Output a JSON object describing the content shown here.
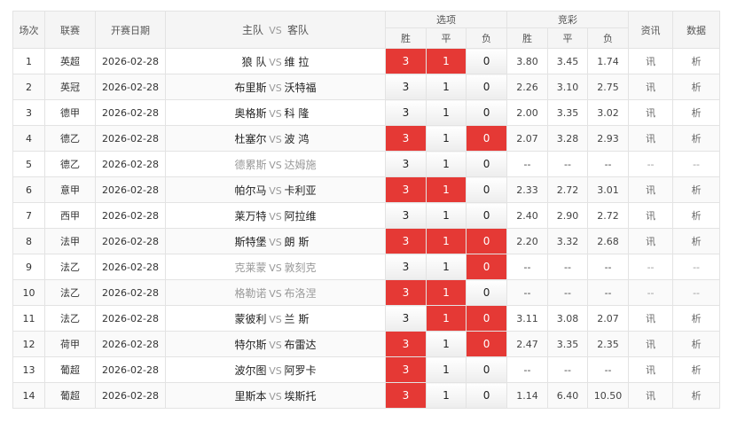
{
  "header": {
    "index": "场次",
    "league": "联赛",
    "date": "开赛日期",
    "home": "主队",
    "vs": "VS",
    "away": "客队",
    "options": "选项",
    "jingcai": "竞彩",
    "news": "资讯",
    "stats": "数据",
    "sub": [
      "胜",
      "平",
      "负",
      "胜",
      "平",
      "负"
    ]
  },
  "rows": [
    {
      "idx": "1",
      "league": "英超",
      "date": "2026-02-28",
      "home": "狼 队",
      "away": "维 拉",
      "opts": [
        "3",
        "1",
        "0"
      ],
      "sel": [
        true,
        true,
        false
      ],
      "odds": [
        "3.80",
        "3.45",
        "1.74"
      ],
      "news": "讯",
      "stats": "析",
      "grey": false
    },
    {
      "idx": "2",
      "league": "英冠",
      "date": "2026-02-28",
      "home": "布里斯",
      "away": "沃特福",
      "opts": [
        "3",
        "1",
        "0"
      ],
      "sel": [
        false,
        false,
        false
      ],
      "odds": [
        "2.26",
        "3.10",
        "2.75"
      ],
      "news": "讯",
      "stats": "析",
      "grey": false
    },
    {
      "idx": "3",
      "league": "德甲",
      "date": "2026-02-28",
      "home": "奥格斯",
      "away": "科 隆",
      "opts": [
        "3",
        "1",
        "0"
      ],
      "sel": [
        false,
        false,
        false
      ],
      "odds": [
        "2.00",
        "3.35",
        "3.02"
      ],
      "news": "讯",
      "stats": "析",
      "grey": false
    },
    {
      "idx": "4",
      "league": "德乙",
      "date": "2026-02-28",
      "home": "杜塞尔",
      "away": "波 鸿",
      "opts": [
        "3",
        "1",
        "0"
      ],
      "sel": [
        true,
        false,
        true
      ],
      "odds": [
        "2.07",
        "3.28",
        "2.93"
      ],
      "news": "讯",
      "stats": "析",
      "grey": false
    },
    {
      "idx": "5",
      "league": "德乙",
      "date": "2026-02-28",
      "home": "德累斯",
      "away": "达姆施",
      "opts": [
        "3",
        "1",
        "0"
      ],
      "sel": [
        false,
        false,
        false
      ],
      "odds": [
        "--",
        "--",
        "--"
      ],
      "news": "--",
      "stats": "--",
      "grey": true
    },
    {
      "idx": "6",
      "league": "意甲",
      "date": "2026-02-28",
      "home": "帕尔马",
      "away": "卡利亚",
      "opts": [
        "3",
        "1",
        "0"
      ],
      "sel": [
        true,
        true,
        false
      ],
      "odds": [
        "2.33",
        "2.72",
        "3.01"
      ],
      "news": "讯",
      "stats": "析",
      "grey": false
    },
    {
      "idx": "7",
      "league": "西甲",
      "date": "2026-02-28",
      "home": "莱万特",
      "away": "阿拉维",
      "opts": [
        "3",
        "1",
        "0"
      ],
      "sel": [
        false,
        false,
        false
      ],
      "odds": [
        "2.40",
        "2.90",
        "2.72"
      ],
      "news": "讯",
      "stats": "析",
      "grey": false
    },
    {
      "idx": "8",
      "league": "法甲",
      "date": "2026-02-28",
      "home": "斯特堡",
      "away": "朗 斯",
      "opts": [
        "3",
        "1",
        "0"
      ],
      "sel": [
        true,
        true,
        true
      ],
      "odds": [
        "2.20",
        "3.32",
        "2.68"
      ],
      "news": "讯",
      "stats": "析",
      "grey": false
    },
    {
      "idx": "9",
      "league": "法乙",
      "date": "2026-02-28",
      "home": "克莱蒙",
      "away": "敦刻克",
      "opts": [
        "3",
        "1",
        "0"
      ],
      "sel": [
        false,
        false,
        true
      ],
      "odds": [
        "--",
        "--",
        "--"
      ],
      "news": "--",
      "stats": "--",
      "grey": true
    },
    {
      "idx": "10",
      "league": "法乙",
      "date": "2026-02-28",
      "home": "格勒诺",
      "away": "布洛涅",
      "opts": [
        "3",
        "1",
        "0"
      ],
      "sel": [
        true,
        true,
        false
      ],
      "odds": [
        "--",
        "--",
        "--"
      ],
      "news": "--",
      "stats": "--",
      "grey": true
    },
    {
      "idx": "11",
      "league": "法乙",
      "date": "2026-02-28",
      "home": "蒙彼利",
      "away": "兰 斯",
      "opts": [
        "3",
        "1",
        "0"
      ],
      "sel": [
        false,
        true,
        true
      ],
      "odds": [
        "3.11",
        "3.08",
        "2.07"
      ],
      "news": "讯",
      "stats": "析",
      "grey": false
    },
    {
      "idx": "12",
      "league": "荷甲",
      "date": "2026-02-28",
      "home": "特尔斯",
      "away": "布雷达",
      "opts": [
        "3",
        "1",
        "0"
      ],
      "sel": [
        true,
        false,
        true
      ],
      "odds": [
        "2.47",
        "3.35",
        "2.35"
      ],
      "news": "讯",
      "stats": "析",
      "grey": false
    },
    {
      "idx": "13",
      "league": "葡超",
      "date": "2026-02-28",
      "home": "波尔图",
      "away": "阿罗卡",
      "opts": [
        "3",
        "1",
        "0"
      ],
      "sel": [
        true,
        false,
        false
      ],
      "odds": [
        "--",
        "--",
        "--"
      ],
      "news": "讯",
      "stats": "析",
      "grey": false
    },
    {
      "idx": "14",
      "league": "葡超",
      "date": "2026-02-28",
      "home": "里斯本",
      "away": "埃斯托",
      "opts": [
        "3",
        "1",
        "0"
      ],
      "sel": [
        true,
        false,
        false
      ],
      "odds": [
        "1.14",
        "6.40",
        "10.50"
      ],
      "news": "讯",
      "stats": "析",
      "grey": false
    }
  ]
}
